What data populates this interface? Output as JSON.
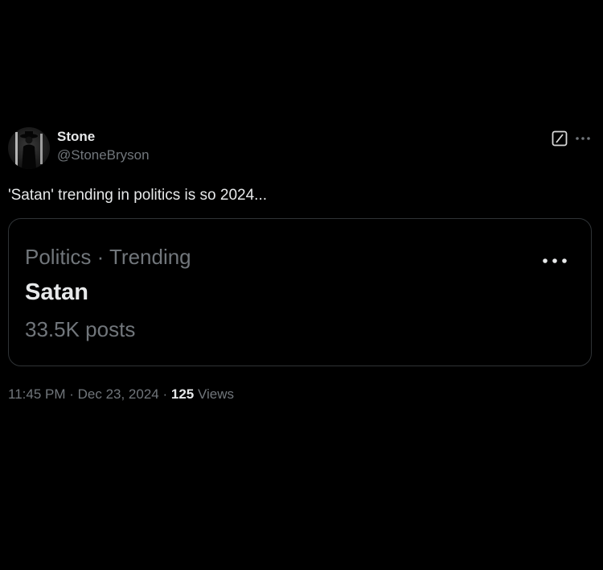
{
  "author": {
    "display_name": "Stone",
    "handle": "@StoneBryson",
    "avatar_icon": "person-silhouette-avatar"
  },
  "header_actions": {
    "grok_icon": "grok-icon",
    "more_icon": "more-horizontal-icon"
  },
  "tweet": {
    "text": "'Satan' trending in politics is so 2024..."
  },
  "trend_card": {
    "context": "Politics · Trending",
    "title": "Satan",
    "posts": "33.5K posts",
    "more_icon": "more-horizontal-icon"
  },
  "meta": {
    "time": "11:45 PM",
    "separator": " · ",
    "date": "Dec 23, 2024",
    "views_count": "125",
    "views_label": "Views"
  },
  "colors": {
    "background": "#000000",
    "primary_text": "#e7e9ea",
    "secondary_text": "#71767b",
    "border": "#2f3336"
  }
}
